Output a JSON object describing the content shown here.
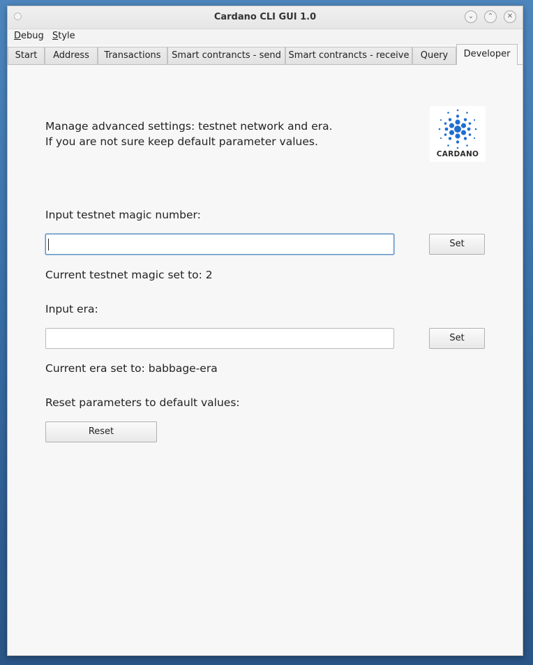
{
  "window": {
    "title": "Cardano CLI GUI 1.0"
  },
  "menubar": {
    "items": [
      {
        "label": "Debug",
        "mnemonic": "D",
        "rest": "ebug"
      },
      {
        "label": "Style",
        "mnemonic": "S",
        "rest": "tyle"
      }
    ]
  },
  "tabs": [
    {
      "label": "Start"
    },
    {
      "label": "Address"
    },
    {
      "label": "Transactions"
    },
    {
      "label": "Smart contrancts - send"
    },
    {
      "label": "Smart contrancts - receive"
    },
    {
      "label": "Query"
    },
    {
      "label": "Developer",
      "active": true
    }
  ],
  "developer": {
    "intro_line1": "Manage advanced settings: testnet network and era.",
    "intro_line2": "If you are not sure keep default parameter values.",
    "logo_text": "CARDANO",
    "magic_label": "Input testnet magic number:",
    "magic_input_value": "",
    "magic_set_button": "Set",
    "magic_current": "Current testnet magic set to: 2",
    "era_label": "Input era:",
    "era_input_value": "",
    "era_set_button": "Set",
    "era_current": "Current era set to: babbage-era",
    "reset_label": "Reset parameters to default values:",
    "reset_button": "Reset"
  },
  "colors": {
    "logo_blue": "#1f6fd0",
    "focus_border": "#5b8fbf"
  }
}
